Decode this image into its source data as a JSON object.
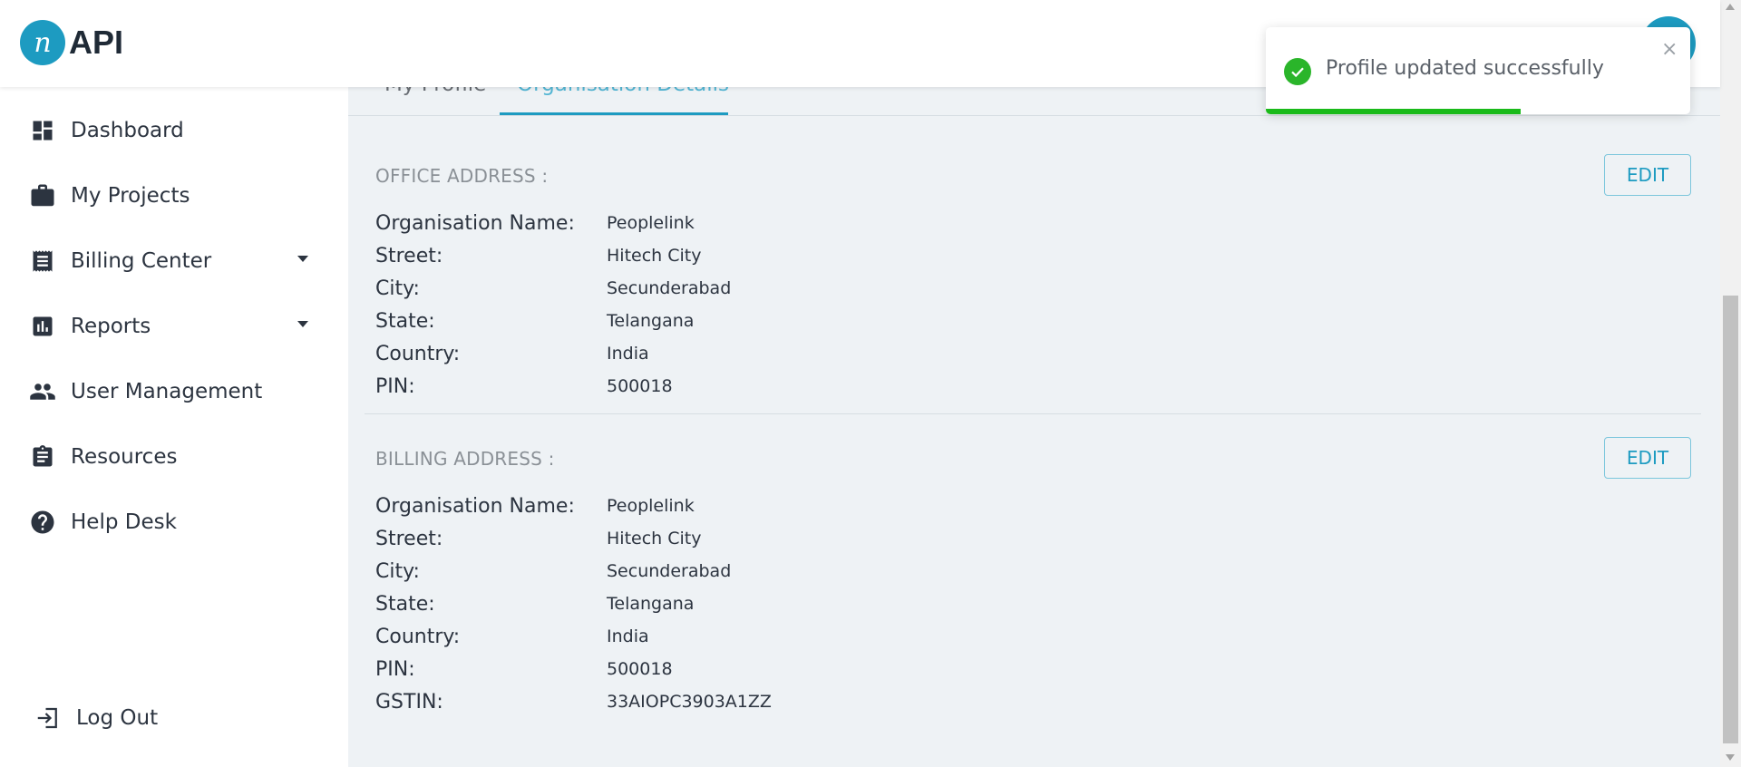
{
  "header": {
    "logo_letter": "n",
    "logo_text": "API"
  },
  "sidebar": {
    "items": [
      {
        "label": "Dashboard",
        "icon": "dashboard-icon"
      },
      {
        "label": "My Projects",
        "icon": "briefcase-icon"
      },
      {
        "label": "Billing Center",
        "icon": "receipt-icon",
        "has_caret": true
      },
      {
        "label": "Reports",
        "icon": "bar-chart-icon",
        "has_caret": true
      },
      {
        "label": "User Management",
        "icon": "people-icon"
      },
      {
        "label": "Resources",
        "icon": "clipboard-icon"
      },
      {
        "label": "Help Desk",
        "icon": "help-icon"
      }
    ],
    "logout_label": "Log Out"
  },
  "tabs": [
    {
      "label": "My Profile",
      "active": false
    },
    {
      "label": "Organisation Details",
      "active": true
    }
  ],
  "office_address": {
    "title": "OFFICE ADDRESS :",
    "edit_label": "EDIT",
    "fields": [
      {
        "label": "Organisation Name:",
        "value": "Peoplelink"
      },
      {
        "label": "Street:",
        "value": "Hitech City"
      },
      {
        "label": "City:",
        "value": "Secunderabad"
      },
      {
        "label": "State:",
        "value": "Telangana"
      },
      {
        "label": "Country:",
        "value": "India"
      },
      {
        "label": "PIN:",
        "value": "500018"
      }
    ]
  },
  "billing_address": {
    "title": "BILLING ADDRESS :",
    "edit_label": "EDIT",
    "fields": [
      {
        "label": "Organisation Name:",
        "value": "Peoplelink"
      },
      {
        "label": "Street:",
        "value": "Hitech City"
      },
      {
        "label": "City:",
        "value": "Secunderabad"
      },
      {
        "label": "State:",
        "value": "Telangana"
      },
      {
        "label": "Country:",
        "value": "India"
      },
      {
        "label": "PIN:",
        "value": "500018"
      },
      {
        "label": "GSTIN:",
        "value": "33AIOPC3903A1ZZ"
      }
    ]
  },
  "toast": {
    "message": "Profile updated successfully",
    "close_symbol": "×",
    "progress": 0.6
  },
  "colors": {
    "accent": "#1d9bc1",
    "success": "#2ab52a",
    "main_bg": "#eef2f5"
  }
}
